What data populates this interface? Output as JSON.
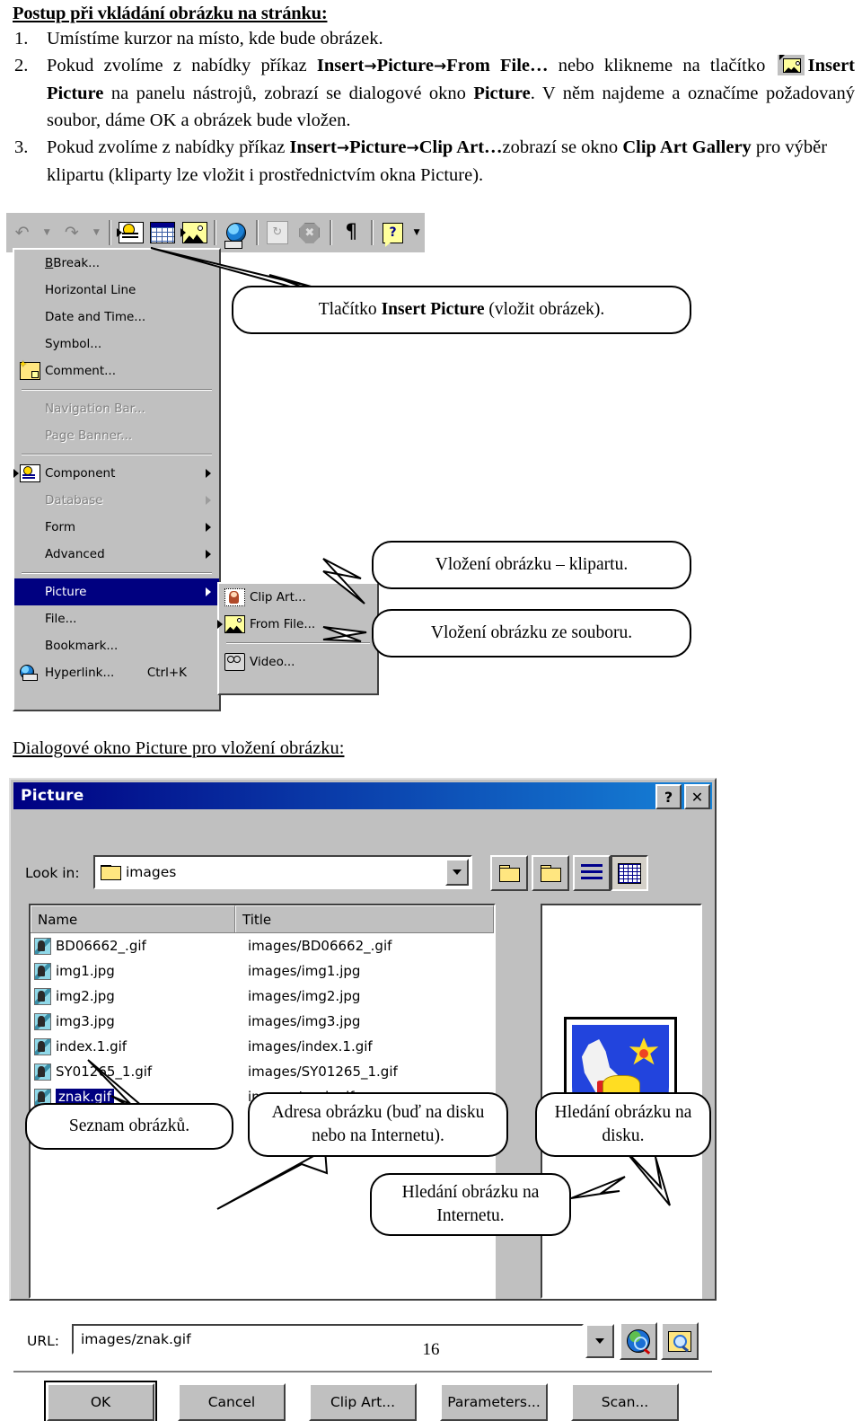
{
  "document": {
    "heading": "Postup při vkládání obrázku na stránku:",
    "steps": [
      {
        "num": "1.",
        "parts": [
          {
            "t": "Umístíme kurzor na místo, kde bude obrázek.",
            "b": false
          }
        ]
      },
      {
        "num": "2.",
        "text_a": "Pokud zvolíme z nabídky příkaz ",
        "cmd_a1": "Insert",
        "cmd_a2": "Picture",
        "cmd_a3": "From File…",
        "text_b": " nebo klikneme na tlačítko ",
        "icon_name": "insert-picture-toolbar-icon",
        "cmd_b": "Insert Picture",
        "text_c": " na panelu nástrojů, zobrazí se dialogové okno ",
        "cmd_c": "Picture",
        "text_d": ". V něm najdeme a označíme požadovaný soubor, dáme OK a obrázek bude vložen."
      },
      {
        "num": "3.",
        "text_a": "Pokud zvolíme z nabídky příkaz ",
        "cmd_a1": "Insert",
        "cmd_a2": "Picture",
        "cmd_a3": "Clip Art…",
        "text_b": "zobrazí se okno ",
        "cmd_b": "Clip Art Gallery",
        "text_c": " pro výběr klipartu (kliparty lze vložit i prostřednictvím okna Picture)."
      }
    ],
    "dialog_caption": "Dialogové okno Picture pro vložení obrázku:",
    "page_number": "16"
  },
  "toolbar": {
    "items": [
      {
        "name": "undo-icon",
        "glyph": "↶"
      },
      {
        "name": "undo-dropdown-arrow",
        "glyph": "▼"
      },
      {
        "name": "redo-icon",
        "glyph": "↷"
      },
      {
        "name": "redo-dropdown-arrow",
        "glyph": "▼"
      },
      {
        "name": "insert-component-icon",
        "glyph": ""
      },
      {
        "name": "insert-table-icon",
        "glyph": ""
      },
      {
        "name": "insert-picture-icon",
        "glyph": ""
      },
      {
        "name": "insert-hyperlink-icon",
        "glyph": ""
      },
      {
        "name": "refresh-icon",
        "glyph": ""
      },
      {
        "name": "stop-icon",
        "glyph": ""
      },
      {
        "name": "show-paragraph-marks-icon",
        "glyph": "¶"
      },
      {
        "name": "help-icon",
        "glyph": "?"
      },
      {
        "name": "toolbar-overflow-arrow",
        "glyph": "▼"
      }
    ]
  },
  "insert_menu": {
    "items": [
      {
        "label": "Break...",
        "accel": "B",
        "disabled": false,
        "submenu": false,
        "icon": null
      },
      {
        "label": "Horizontal Line",
        "accel": "L",
        "disabled": false,
        "submenu": false,
        "icon": null
      },
      {
        "label": "Date and Time...",
        "accel": "T",
        "disabled": false,
        "submenu": false,
        "icon": null
      },
      {
        "label": "Symbol...",
        "accel": "S",
        "disabled": false,
        "submenu": false,
        "icon": null
      },
      {
        "label": "Comment...",
        "accel": "C",
        "disabled": false,
        "submenu": false,
        "icon": "comment-icon"
      },
      {
        "separator": true
      },
      {
        "label": "Navigation Bar...",
        "accel": "v",
        "disabled": true,
        "submenu": false,
        "icon": null
      },
      {
        "label": "Page Banner...",
        "accel": "n",
        "disabled": true,
        "submenu": false,
        "icon": null
      },
      {
        "separator": true
      },
      {
        "label": "Component",
        "accel": "o",
        "disabled": false,
        "submenu": true,
        "icon": "component-icon"
      },
      {
        "label": "Database",
        "accel": "D",
        "disabled": true,
        "submenu": true,
        "icon": null
      },
      {
        "label": "Form",
        "accel": "m",
        "disabled": false,
        "submenu": true,
        "icon": null
      },
      {
        "label": "Advanced",
        "accel": "A",
        "disabled": false,
        "submenu": true,
        "icon": null
      },
      {
        "separator": true
      },
      {
        "label": "Picture",
        "accel": "P",
        "disabled": false,
        "submenu": true,
        "selected": true,
        "icon": null
      },
      {
        "label": "File...",
        "accel": "F",
        "disabled": false,
        "submenu": false,
        "icon": null
      },
      {
        "label": "Bookmark...",
        "accel": "k",
        "disabled": false,
        "submenu": false,
        "icon": null
      },
      {
        "label": "Hyperlink...",
        "accel": "H",
        "shortcut": "Ctrl+K",
        "disabled": false,
        "submenu": false,
        "icon": "hyperlink-icon"
      }
    ]
  },
  "picture_submenu": {
    "items": [
      {
        "label": "Clip Art...",
        "icon": "clipart-icon"
      },
      {
        "label": "From File...",
        "icon": "picture-icon"
      },
      {
        "separator": true
      },
      {
        "label": "Video...",
        "icon": "video-icon"
      }
    ]
  },
  "callouts": {
    "insert_picture_button": {
      "pre": "Tlačítko ",
      "bold": "Insert Picture",
      "post": " (vložit obrázek)."
    },
    "clipart": "Vložení obrázku – klipartu.",
    "from_file": "Vložení obrázku ze souboru.",
    "file_list": "Seznam obrázků.",
    "address": "Adresa obrázku (buď na disku nebo na Internetu).",
    "search_disk": "Hledání obrázku na disku.",
    "search_internet": "Hledání obrázku na Internetu."
  },
  "picture_dialog": {
    "title": "Picture",
    "help_button": "?",
    "close_button": "✕",
    "look_in_label": "Look in:",
    "look_in_value": "images",
    "toolbar_buttons": [
      {
        "name": "up-one-level-icon"
      },
      {
        "name": "new-folder-icon"
      },
      {
        "name": "list-view-icon"
      },
      {
        "name": "details-view-icon"
      }
    ],
    "columns": [
      "Name",
      "Title"
    ],
    "files": [
      {
        "name": "BD06662_.gif",
        "title": "images/BD06662_.gif",
        "selected": false
      },
      {
        "name": "img1.jpg",
        "title": "images/img1.jpg",
        "selected": false
      },
      {
        "name": "img2.jpg",
        "title": "images/img2.jpg",
        "selected": false
      },
      {
        "name": "img3.jpg",
        "title": "images/img3.jpg",
        "selected": false
      },
      {
        "name": "index.1.gif",
        "title": "images/index.1.gif",
        "selected": false
      },
      {
        "name": "SY01265_1.gif",
        "title": "images/SY01265_1.gif",
        "selected": false
      },
      {
        "name": "znak.gif",
        "title": "images/znak.gif",
        "selected": true
      }
    ],
    "url_label": "URL:",
    "url_value": "images/znak.gif",
    "buttons": [
      {
        "label": "OK",
        "accel": "",
        "default": true
      },
      {
        "label": "Cancel",
        "accel": "",
        "default": false
      },
      {
        "label": "Clip Art...",
        "accel": "C",
        "default": false
      },
      {
        "label": "Parameters...",
        "accel": "P",
        "default": false
      },
      {
        "label": "Scan...",
        "accel": "S",
        "default": false
      }
    ],
    "search_internet_button": "search-internet-icon",
    "search_disk_button": "search-disk-icon"
  },
  "colors": {
    "title_bar_start": "#000082",
    "title_bar_end": "#1683d8",
    "dialog_face": "#c0c0c0",
    "selection": "#000080",
    "menu_face": "#c0c0c0"
  }
}
